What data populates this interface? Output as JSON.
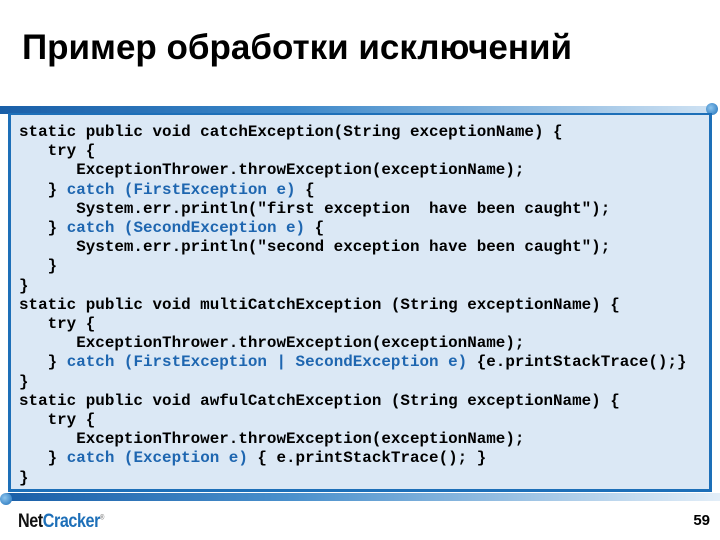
{
  "slide": {
    "title": "Пример обработки исключений",
    "page_number": "59",
    "logo": {
      "part1": "Net",
      "part2": "Cracker",
      "mark": "®"
    },
    "colors": {
      "accent": "#1d6fb8",
      "code_background": "#dbe8f5",
      "keyword_blue": "#1e66b0"
    }
  },
  "code_lines": [
    [
      {
        "t": "static public void catchException(String exceptionName) {",
        "c": "k"
      }
    ],
    [
      {
        "t": "   try {",
        "c": "k"
      }
    ],
    [
      {
        "t": "      ExceptionThrower.throwException(exceptionName);",
        "c": "k"
      }
    ],
    [
      {
        "t": "   } ",
        "c": "k"
      },
      {
        "t": "catch (FirstException e)",
        "c": "b"
      },
      {
        "t": " {",
        "c": "k"
      }
    ],
    [
      {
        "t": "      System.err.println(\"first exception  have been caught\");",
        "c": "k"
      }
    ],
    [
      {
        "t": "   } ",
        "c": "k"
      },
      {
        "t": "catch (SecondException e)",
        "c": "b"
      },
      {
        "t": " {",
        "c": "k"
      }
    ],
    [
      {
        "t": "      System.err.println(\"second exception have been caught\");",
        "c": "k"
      }
    ],
    [
      {
        "t": "   }",
        "c": "k"
      }
    ],
    [
      {
        "t": "}",
        "c": "k"
      }
    ],
    [
      {
        "t": "static public void multiCatchException (String exceptionName) {",
        "c": "k"
      }
    ],
    [
      {
        "t": "   try {",
        "c": "k"
      }
    ],
    [
      {
        "t": "      ExceptionThrower.throwException(exceptionName);",
        "c": "k"
      }
    ],
    [
      {
        "t": "   } ",
        "c": "k"
      },
      {
        "t": "catch (FirstException | SecondException e)",
        "c": "b"
      },
      {
        "t": " {e.printStackTrace();}",
        "c": "k"
      }
    ],
    [
      {
        "t": "}",
        "c": "k"
      }
    ],
    [
      {
        "t": "static public void awfulCatchException (String exceptionName) {",
        "c": "k"
      }
    ],
    [
      {
        "t": "   try {",
        "c": "k"
      }
    ],
    [
      {
        "t": "      ExceptionThrower.throwException(exceptionName);",
        "c": "k"
      }
    ],
    [
      {
        "t": "   } ",
        "c": "k"
      },
      {
        "t": "catch (Exception e)",
        "c": "b"
      },
      {
        "t": " { e.printStackTrace(); }",
        "c": "k"
      }
    ],
    [
      {
        "t": "}",
        "c": "k"
      }
    ]
  ]
}
